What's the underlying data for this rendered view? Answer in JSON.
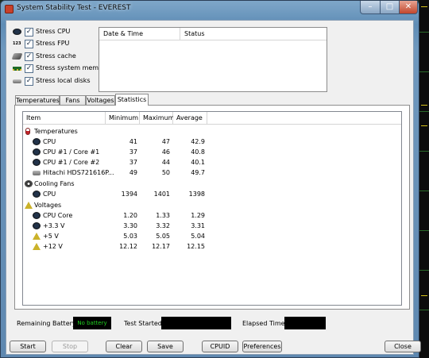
{
  "window": {
    "title": "System Stability Test - EVEREST"
  },
  "stress_options": [
    {
      "label": "Stress CPU",
      "checked": true,
      "icon": "cpu-chip-icon"
    },
    {
      "label": "Stress FPU",
      "checked": true,
      "icon": "fpu-icon"
    },
    {
      "label": "Stress cache",
      "checked": true,
      "icon": "cache-icon"
    },
    {
      "label": "Stress system memory",
      "checked": true,
      "icon": "memory-module-icon"
    },
    {
      "label": "Stress local disks",
      "checked": true,
      "icon": "disk-icon"
    }
  ],
  "log": {
    "headers": [
      "Date & Time",
      "Status"
    ]
  },
  "tabs": [
    "Temperatures",
    "Fans",
    "Voltages",
    "Statistics"
  ],
  "active_tab": "Statistics",
  "stats_table": {
    "headers": [
      "Item",
      "Minimum",
      "Maximum",
      "Average"
    ],
    "rows": [
      {
        "kind": "group",
        "icon": "thermometer-icon",
        "label": "Temperatures"
      },
      {
        "kind": "item",
        "icon": "cpu-icon",
        "label": "CPU",
        "min": "41",
        "max": "47",
        "avg": "42.9"
      },
      {
        "kind": "item",
        "icon": "cpu-icon",
        "label": "CPU #1 / Core #1",
        "min": "37",
        "max": "46",
        "avg": "40.8"
      },
      {
        "kind": "item",
        "icon": "cpu-icon",
        "label": "CPU #1 / Core #2",
        "min": "37",
        "max": "44",
        "avg": "40.1"
      },
      {
        "kind": "item",
        "icon": "hard-drive-icon",
        "label": "Hitachi HDS721616P...",
        "min": "49",
        "max": "50",
        "avg": "49.7"
      },
      {
        "kind": "group",
        "icon": "fan-icon",
        "label": "Cooling Fans"
      },
      {
        "kind": "item",
        "icon": "cpu-icon",
        "label": "CPU",
        "min": "1394",
        "max": "1401",
        "avg": "1398"
      },
      {
        "kind": "group",
        "icon": "voltage-icon",
        "label": "Voltages"
      },
      {
        "kind": "item",
        "icon": "cpu-icon",
        "label": "CPU Core",
        "min": "1.20",
        "max": "1.33",
        "avg": "1.29"
      },
      {
        "kind": "item",
        "icon": "cpu-icon",
        "label": "+3.3 V",
        "min": "3.30",
        "max": "3.32",
        "avg": "3.31"
      },
      {
        "kind": "item",
        "icon": "voltage-icon",
        "label": "+5 V",
        "min": "5.03",
        "max": "5.05",
        "avg": "5.04"
      },
      {
        "kind": "item",
        "icon": "voltage-icon",
        "label": "+12 V",
        "min": "12.12",
        "max": "12.17",
        "avg": "12.15"
      }
    ]
  },
  "status": {
    "battery_label": "Remaining Battery:",
    "battery_value": "No battery",
    "test_started_label": "Test Started:",
    "test_started_value": "",
    "elapsed_label": "Elapsed Time:",
    "elapsed_value": ""
  },
  "buttons": {
    "start": "Start",
    "stop": "Stop",
    "clear": "Clear",
    "save": "Save",
    "cpuid": "CPUID",
    "preferences": "Preferences",
    "close": "Close"
  },
  "colors": {
    "battery_text": "#20d020",
    "titlebar": "#6f98be"
  }
}
